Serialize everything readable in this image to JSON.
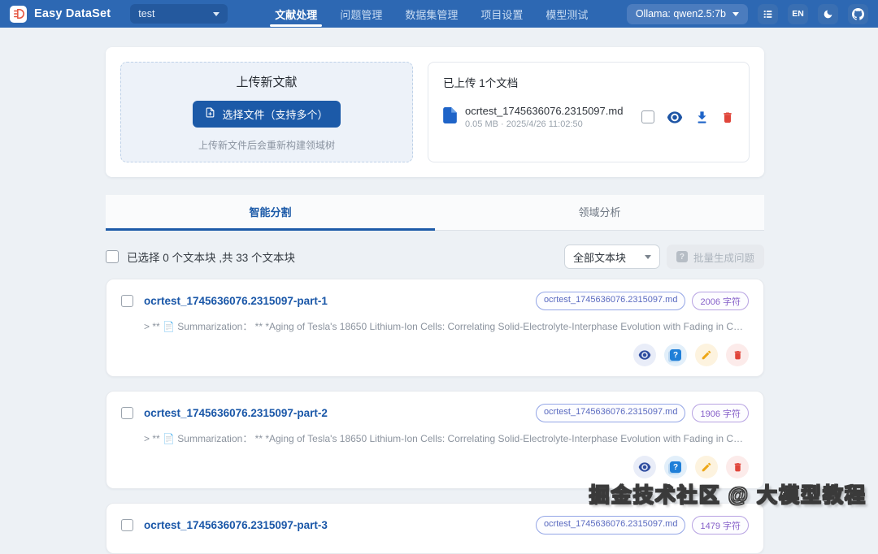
{
  "colors": {
    "header_bg": "#2d68b3",
    "primary": "#1c5aa8",
    "danger": "#e0453a",
    "warning": "#eda718",
    "chip_file_text": "#5a6ac0",
    "chip_chars_text": "#8660c9"
  },
  "header": {
    "app_name": "Easy DataSet",
    "project_select_value": "test",
    "nav": [
      {
        "label": "文献处理",
        "active": true
      },
      {
        "label": "问题管理",
        "active": false
      },
      {
        "label": "数据集管理",
        "active": false
      },
      {
        "label": "项目设置",
        "active": false
      },
      {
        "label": "模型测试",
        "active": false
      }
    ],
    "model_select_value": "Ollama: qwen2.5:7b",
    "language_label": "EN"
  },
  "upload_panel": {
    "title": "上传新文献",
    "choose_button": "选择文件（支持多个）",
    "hint": "上传新文件后会重新构建领域树"
  },
  "uploaded_panel": {
    "title": "已上传 1个文档",
    "file_name": "ocrtest_1745636076.2315097.md",
    "file_meta": "0.05 MB · 2025/4/26 11:02:50"
  },
  "tabs": [
    {
      "label": "智能分割",
      "active": true
    },
    {
      "label": "领域分析",
      "active": false
    }
  ],
  "toolbar": {
    "selection_summary": "已选择 0 个文本块 ,共 33 个文本块",
    "filter_value": "全部文本块",
    "batch_button": "批量生成问题"
  },
  "chunks": [
    {
      "title": "ocrtest_1745636076.2315097-part-1",
      "file_chip": "ocrtest_1745636076.2315097.md",
      "char_chip": "2006 字符",
      "snippet": "> ** 📄 Summarization： ** *Aging of Tesla's 18650 Lithium-Ion Cells: Correlating Solid-Electrolyte-Interphase Evolution with Fading in Capacity and Powe..."
    },
    {
      "title": "ocrtest_1745636076.2315097-part-2",
      "file_chip": "ocrtest_1745636076.2315097.md",
      "char_chip": "1906 字符",
      "snippet": "> ** 📄 Summarization： ** *Aging of Tesla's 18650 Lithium-Ion Cells: Correlating Solid-Electrolyte-Interphase Evolution with Fading in Capacity and Powe..."
    },
    {
      "title": "ocrtest_1745636076.2315097-part-3",
      "file_chip": "ocrtest_1745636076.2315097.md",
      "char_chip": "1479 字符",
      "snippet": ""
    }
  ],
  "watermark": "掘金技术社区 @ 大模型教程"
}
